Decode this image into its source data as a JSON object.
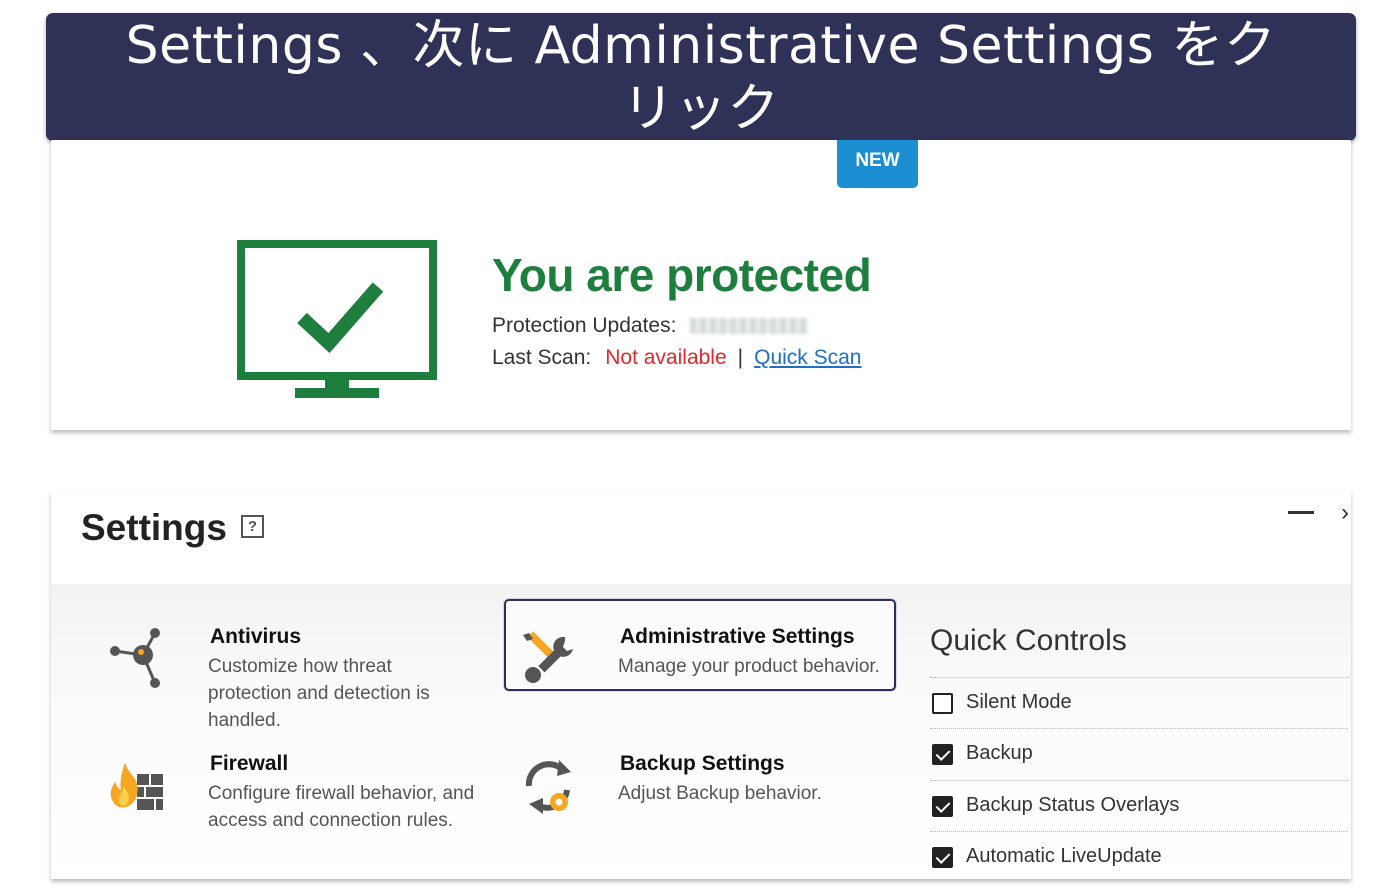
{
  "banner": {
    "line1": "Settings 、次に Administrative Settings をク",
    "line2": "リック"
  },
  "status": {
    "new_badge": "NEW",
    "title": "You are protected",
    "updates_label": "Protection Updates:",
    "last_scan_label": "Last Scan:",
    "last_scan_value": "Not available",
    "separator": "|",
    "quick_scan_link": "Quick Scan",
    "colors": {
      "protected": "#1e7e3e",
      "warning": "#e0282e",
      "link": "#1f6fc5"
    }
  },
  "settings": {
    "title": "Settings",
    "help_label": "?",
    "minimize_icon": "minimize-icon",
    "items": [
      {
        "title": "Antivirus",
        "desc_lines": [
          "Customize how threat",
          "protection and detection is",
          "handled."
        ],
        "icon": "antivirus-network-icon"
      },
      {
        "title": "Administrative Settings",
        "desc_lines": [
          "Manage your product behavior."
        ],
        "icon": "wrench-pencil-icon"
      },
      {
        "title": "Firewall",
        "desc_lines": [
          "Configure firewall behavior, and",
          "access and connection rules."
        ],
        "icon": "firewall-flame-icon"
      },
      {
        "title": "Backup Settings",
        "desc_lines": [
          "Adjust Backup behavior."
        ],
        "icon": "backup-gear-icon"
      }
    ],
    "quick_controls": {
      "title": "Quick Controls",
      "items": [
        {
          "label": "Silent Mode",
          "checked": false
        },
        {
          "label": "Backup",
          "checked": true
        },
        {
          "label": "Backup Status Overlays",
          "checked": true
        },
        {
          "label": "Automatic LiveUpdate",
          "checked": true
        }
      ]
    }
  }
}
